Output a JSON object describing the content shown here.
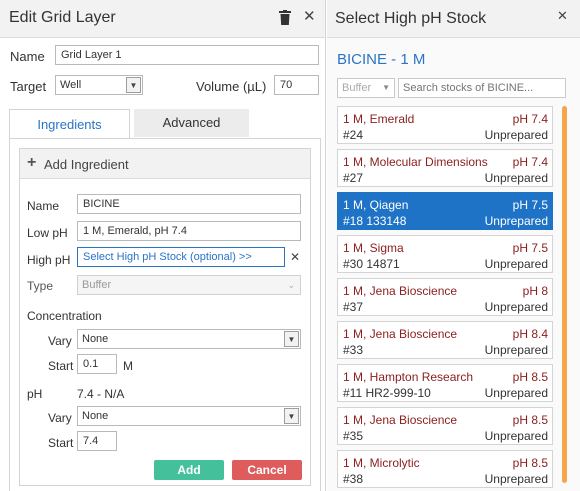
{
  "left": {
    "title": "Edit Grid Layer",
    "name_label": "Name",
    "name_value": "Grid Layer 1",
    "target_label": "Target",
    "target_value": "Well",
    "volume_label": "Volume (µL)",
    "volume_value": "70",
    "tabs": [
      {
        "label": "Ingredients"
      },
      {
        "label": "Advanced"
      }
    ],
    "ingredient": {
      "header": "Add Ingredient",
      "name_label": "Name",
      "name_value": "BICINE",
      "low_ph_label": "Low pH",
      "low_ph_value": "1 M, Emerald, pH 7.4",
      "high_ph_label": "High pH",
      "high_ph_placeholder": "Select High pH Stock (optional) >>",
      "type_label": "Type",
      "type_value": "Buffer",
      "concentration_label": "Concentration",
      "conc_vary_label": "Vary",
      "conc_vary_value": "None",
      "conc_start_label": "Start",
      "conc_start_value": "0.1",
      "conc_unit": "M",
      "ph_label": "pH",
      "ph_range": "7.4 - N/A",
      "ph_vary_label": "Vary",
      "ph_vary_value": "None",
      "ph_start_label": "Start",
      "ph_start_value": "7.4",
      "add_label": "Add",
      "cancel_label": "Cancel"
    }
  },
  "right": {
    "title": "Select High pH Stock",
    "heading": "BICINE - 1 M",
    "buffer_filter": "Buffer",
    "search_placeholder": "Search stocks of BICINE...",
    "stocks": [
      {
        "name": "1 M, Emerald",
        "ph": "pH 7.4",
        "id": "#24",
        "status": "Unprepared"
      },
      {
        "name": "1 M, Molecular Dimensions",
        "ph": "pH 7.4",
        "id": "#27",
        "status": "Unprepared"
      },
      {
        "name": "1 M, Qiagen",
        "ph": "pH 7.5",
        "id": "#18 133148",
        "status": "Unprepared"
      },
      {
        "name": "1 M, Sigma",
        "ph": "pH 7.5",
        "id": "#30 14871",
        "status": "Unprepared"
      },
      {
        "name": "1 M, Jena Bioscience",
        "ph": "pH 8",
        "id": "#37",
        "status": "Unprepared"
      },
      {
        "name": "1 M, Jena Bioscience",
        "ph": "pH 8.4",
        "id": "#33",
        "status": "Unprepared"
      },
      {
        "name": "1 M, Hampton Research",
        "ph": "pH 8.5",
        "id": "#11 HR2-999-10",
        "status": "Unprepared"
      },
      {
        "name": "1 M, Jena Bioscience",
        "ph": "pH 8.5",
        "id": "#35",
        "status": "Unprepared"
      },
      {
        "name": "1 M, Microlytic",
        "ph": "pH 8.5",
        "id": "#38",
        "status": "Unprepared"
      }
    ]
  },
  "colors": {
    "accent": "#2a74c6",
    "selected": "#1f73c7",
    "add": "#44c09b",
    "cancel": "#de5c5c",
    "stock_name": "#8b1e1e",
    "scrollbar": "#f5a54a"
  }
}
